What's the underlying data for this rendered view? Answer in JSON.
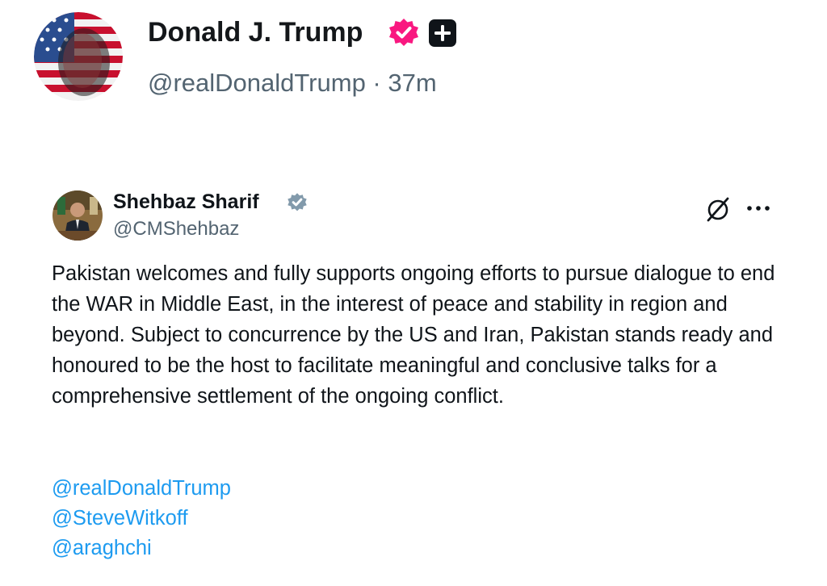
{
  "post": {
    "author": {
      "display_name": "Donald J. Trump",
      "handle": "@realDonaldTrump",
      "time_ago": "37m",
      "verified_badge_color": "#f91880",
      "badge_icons": [
        "verified-badge-icon",
        "plus-badge-icon"
      ]
    },
    "meta_separator": " · "
  },
  "quoted_post": {
    "author": {
      "display_name": "Shehbaz Sharif",
      "handle": "@CMShehbaz",
      "badge_icon": "verified-badge-icon",
      "badge_color": "#829aab"
    },
    "action_icons": [
      "grok-icon",
      "more-options-icon"
    ],
    "text": "Pakistan welcomes and fully supports ongoing efforts to pursue dialogue to end the WAR in Middle East, in the interest of peace and stability in region and beyond. Subject to concurrence by the US and Iran, Pakistan stands ready and honoured to be the host to facilitate meaningful and conclusive talks for a comprehensive settlement of the ongoing conflict.",
    "mentions": [
      "@realDonaldTrump",
      "@SteveWitkoff",
      "@araghchi"
    ]
  },
  "colors": {
    "link": "#1d9bf0",
    "secondary_text": "#536471",
    "primary_text": "#0f1419"
  }
}
